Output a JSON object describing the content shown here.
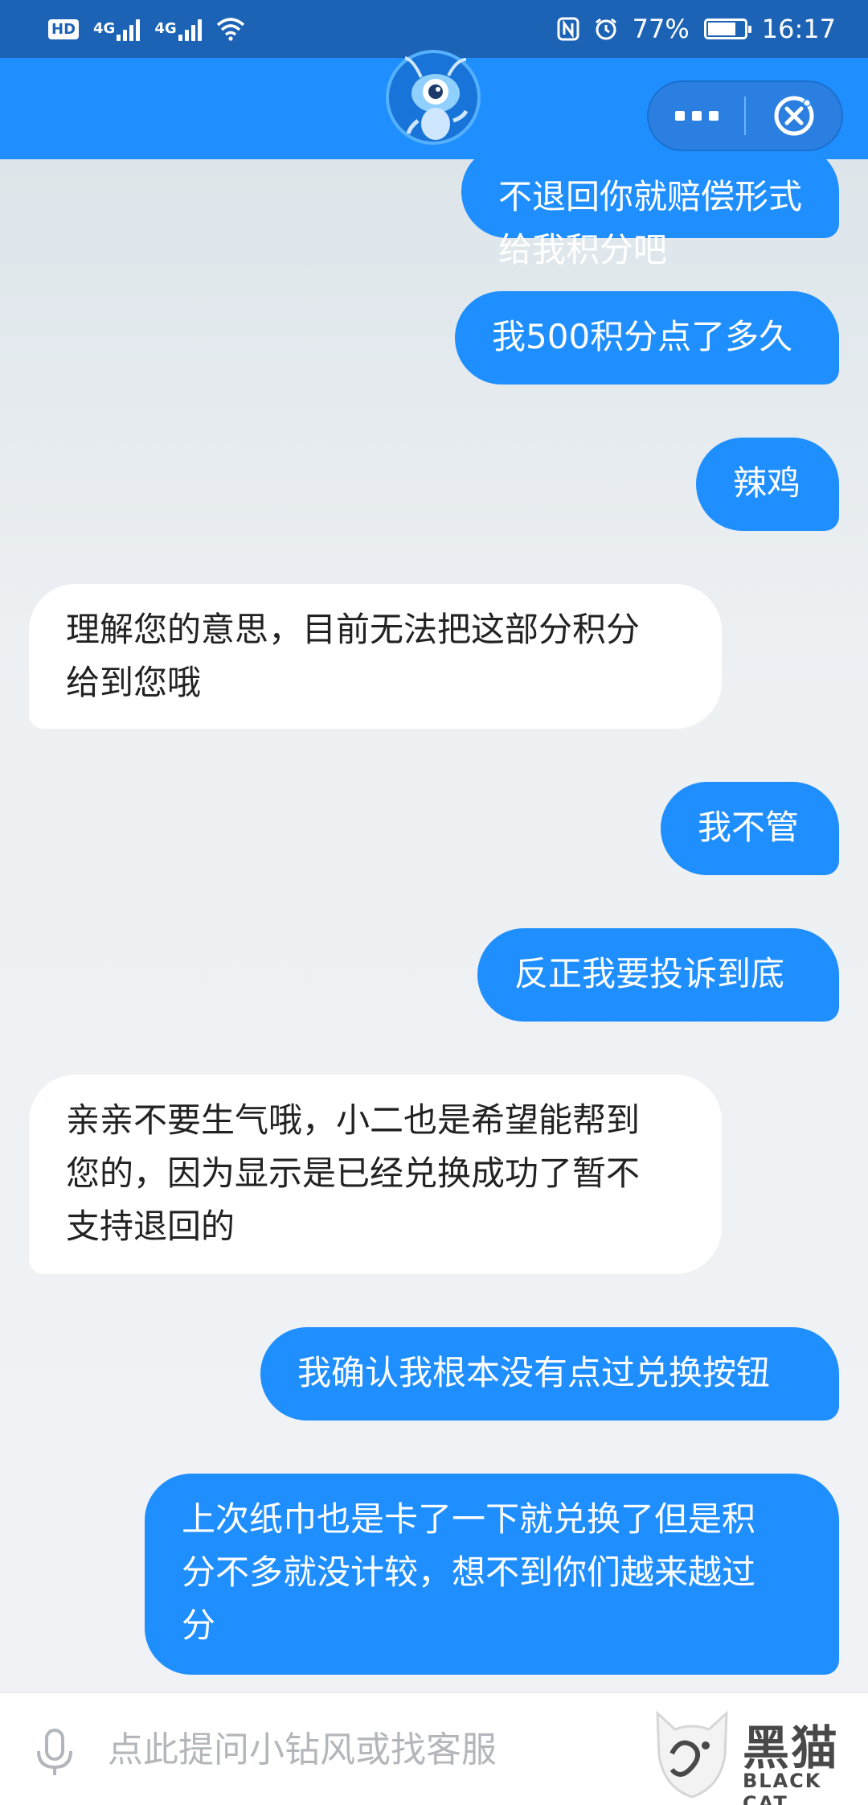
{
  "status_bar": {
    "hd_label": "HD",
    "net1": "4G",
    "net2": "4G",
    "battery_percent": "77%",
    "battery_level": 0.77,
    "time": "16:17",
    "icons": [
      "hd-icon",
      "signal-icon",
      "wifi-icon",
      "nfc-icon",
      "alarm-icon",
      "battery-icon"
    ]
  },
  "header": {
    "mascot_icon": "ant-mascot-avatar",
    "more_icon": "more-dots-icon",
    "close_icon": "mini-program-close-icon"
  },
  "messages": [
    {
      "from": "me",
      "text": "不退回你就赔偿形式给我积分吧"
    },
    {
      "from": "me",
      "text": "我500积分点了多久"
    },
    {
      "from": "me",
      "text": "辣鸡"
    },
    {
      "from": "bot",
      "lines": [
        "理解您的意思，目前无法把这部分积分",
        "给到您哦"
      ]
    },
    {
      "from": "me",
      "text": "我不管"
    },
    {
      "from": "me",
      "text": "反正我要投诉到底"
    },
    {
      "from": "bot",
      "lines": [
        "亲亲不要生气哦，小二也是希望能帮到",
        "您的，因为显示是已经兑换成功了暂不",
        "支持退回的"
      ]
    },
    {
      "from": "me",
      "text": "我确认我根本没有点过兑换按钮"
    },
    {
      "from": "me",
      "lines": [
        "上次纸巾也是卡了一下就兑换了但是积",
        "分不多就没计较，想不到你们越来越过",
        "分"
      ]
    }
  ],
  "input": {
    "placeholder": "点此提问小钻风或找客服",
    "mic_icon": "microphone-icon"
  },
  "watermark": {
    "cn": "黑猫",
    "en": "BLACK CAT"
  },
  "colors": {
    "status_bar": "#1d63b5",
    "title_bar": "#1f8fff",
    "my_bubble": "#1f8fff",
    "bot_bubble": "#ffffff",
    "chat_bg": "#eef1f4"
  }
}
